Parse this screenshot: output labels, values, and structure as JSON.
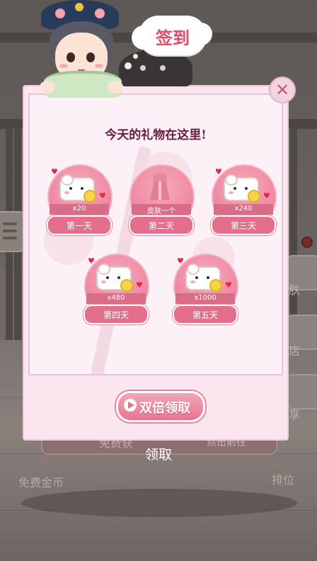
{
  "header": {
    "title": "签到"
  },
  "popup": {
    "heading": "今天的礼物在这里!",
    "days": [
      {
        "reward": "x20",
        "label": "第一天",
        "icon": "coin-bag-icon"
      },
      {
        "reward": "皮肤一个",
        "label": "第二天",
        "icon": "skin-dress-icon"
      },
      {
        "reward": "x240",
        "label": "第三天",
        "icon": "coin-bag-icon"
      },
      {
        "reward": "x480",
        "label": "第四天",
        "icon": "coin-bag-icon"
      },
      {
        "reward": "x1000",
        "label": "第五天",
        "icon": "coin-bag-icon"
      }
    ],
    "double_claim_label": "双倍领取",
    "close_icon": "close-icon"
  },
  "background": {
    "banner_left": "免费获",
    "banner_right": "点击前往",
    "claim_text": "领取",
    "free_coins": "免费金币",
    "rank": "排位",
    "side_labels": [
      "肤",
      "店",
      "享"
    ]
  },
  "colors": {
    "accent_pink": "#e36f8c",
    "heading": "#6b1d39",
    "title": "#d8526f"
  }
}
